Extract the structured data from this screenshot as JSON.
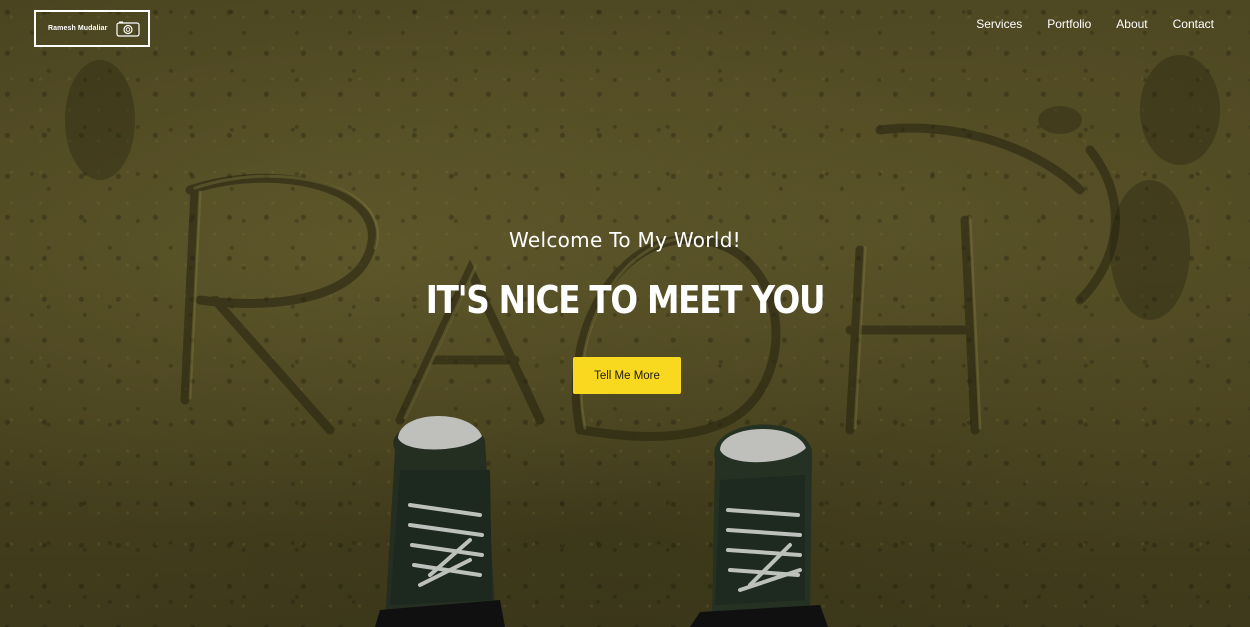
{
  "header": {
    "logo_text": "Ramesh Mudaliar",
    "logo_icon": "camera-icon",
    "nav": [
      {
        "label": "Services"
      },
      {
        "label": "Portfolio"
      },
      {
        "label": "About"
      },
      {
        "label": "Contact"
      }
    ]
  },
  "hero": {
    "welcome": "Welcome To My World!",
    "headline": "IT'S NICE TO MEET YOU",
    "cta_label": "Tell Me More",
    "background_image": "sand writing with sneakers"
  },
  "colors": {
    "accent": "#f9d820",
    "text": "#ffffff"
  }
}
